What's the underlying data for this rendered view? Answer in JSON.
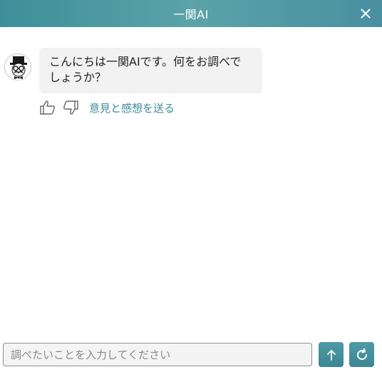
{
  "header": {
    "title": "一関AI",
    "close_icon": "close-icon"
  },
  "messages": [
    {
      "sender": "bot",
      "avatar_icon": "gentleman-avatar-icon",
      "text": "こんにちは一関AIです。何をお調べでしょうか？"
    }
  ],
  "feedback": {
    "thumbs_up_icon": "thumbs-up-icon",
    "thumbs_down_icon": "thumbs-down-icon",
    "link_label": "意見と感想を送る"
  },
  "input": {
    "placeholder": "調べたいことを入力してください",
    "value": ""
  },
  "actions": {
    "send_icon": "arrow-up-icon",
    "refresh_icon": "refresh-icon"
  },
  "colors": {
    "accent": "#3c8a9a",
    "header_gradient_start": "#3d8f99",
    "header_gradient_end": "#4a8fa0",
    "bubble_bg": "#f2f2f2"
  }
}
